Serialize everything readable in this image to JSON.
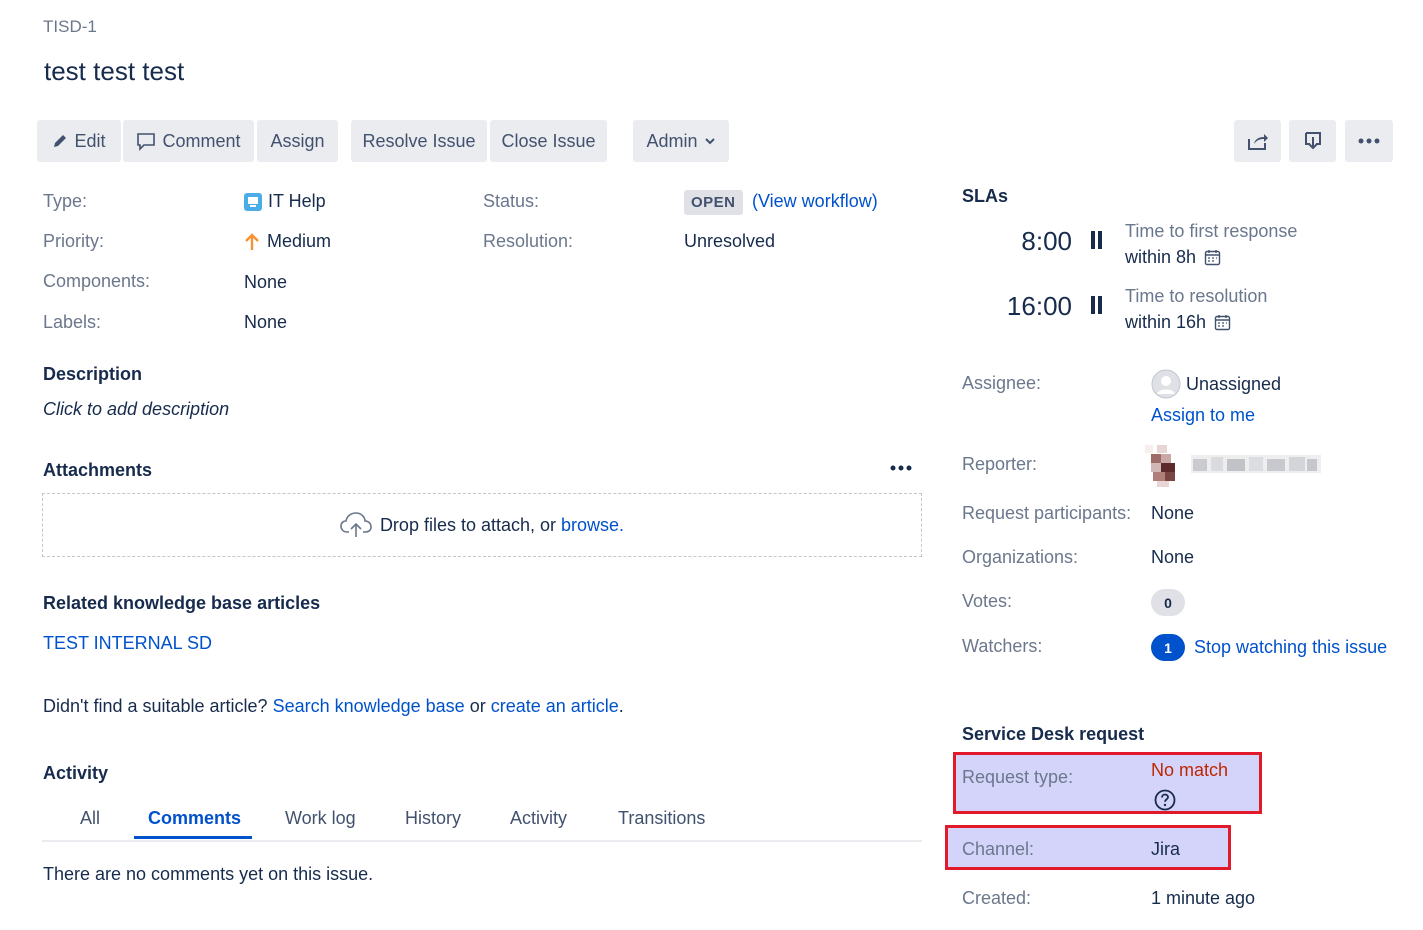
{
  "issue": {
    "key": "TISD-1",
    "title": "test test test"
  },
  "toolbar": {
    "edit": "Edit",
    "comment": "Comment",
    "assign": "Assign",
    "resolve": "Resolve Issue",
    "close": "Close Issue",
    "admin": "Admin"
  },
  "details": {
    "type_label": "Type:",
    "type_value": "IT Help",
    "priority_label": "Priority:",
    "priority_value": "Medium",
    "components_label": "Components:",
    "components_value": "None",
    "labels_label": "Labels:",
    "labels_value": "None",
    "status_label": "Status:",
    "status_value": "OPEN",
    "view_workflow": "(View workflow)",
    "resolution_label": "Resolution:",
    "resolution_value": "Unresolved"
  },
  "description": {
    "heading": "Description",
    "placeholder": "Click to add description"
  },
  "attachments": {
    "heading": "Attachments",
    "drop_text": "Drop files to attach, or ",
    "browse": "browse."
  },
  "kb": {
    "heading": "Related knowledge base articles",
    "article": "TEST INTERNAL SD",
    "prompt": "Didn't find a suitable article? ",
    "search_link": "Search knowledge base",
    "or": " or ",
    "create_link": "create an article",
    "period": "."
  },
  "activity": {
    "heading": "Activity",
    "tabs": [
      "All",
      "Comments",
      "Work log",
      "History",
      "Activity",
      "Transitions"
    ],
    "active_tab": "Comments",
    "empty": "There are no comments yet on this issue."
  },
  "slas": {
    "heading": "SLAs",
    "items": [
      {
        "time": "8:00",
        "name": "Time to first response",
        "within": "within 8h"
      },
      {
        "time": "16:00",
        "name": "Time to resolution",
        "within": "within 16h"
      }
    ]
  },
  "people": {
    "assignee_label": "Assignee:",
    "assignee_value": "Unassigned",
    "assign_to_me": "Assign to me",
    "reporter_label": "Reporter:",
    "participants_label": "Request participants:",
    "participants_value": "None",
    "organizations_label": "Organizations:",
    "organizations_value": "None",
    "votes_label": "Votes:",
    "votes_count": "0",
    "watchers_label": "Watchers:",
    "watchers_count": "1",
    "stop_watching": "Stop watching this issue"
  },
  "service_desk": {
    "heading": "Service Desk request",
    "request_type_label": "Request type:",
    "request_type_value": "No match",
    "channel_label": "Channel:",
    "channel_value": "Jira",
    "created_label": "Created:",
    "created_value": "1 minute ago"
  },
  "colors": {
    "link": "#0052cc",
    "highlight_fill": "#d4d4fb",
    "highlight_border": "#e0192b",
    "no_match": "#bf2600"
  }
}
